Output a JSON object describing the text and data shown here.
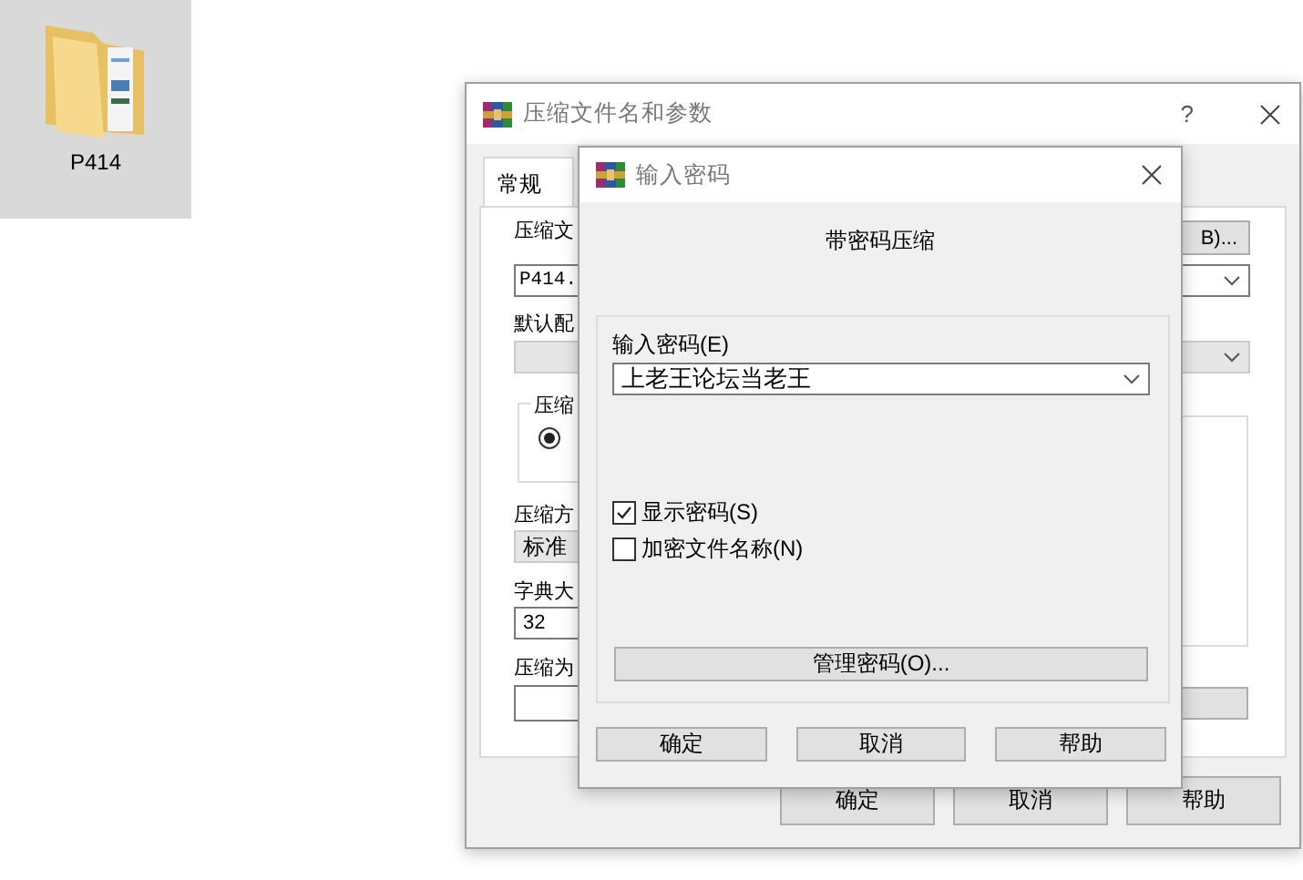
{
  "desktop_icons": [
    {
      "label": "P414",
      "selected": true
    }
  ],
  "back_window": {
    "title": "压缩文件名和参数",
    "help": "?",
    "tabs": [
      {
        "label": "常规",
        "selected": true
      }
    ],
    "archive_name_label": "压缩文",
    "browse_button": "B)...",
    "archive_name": "P414.",
    "profile_label": "默认配",
    "method_group_label": "压缩",
    "format_radio": {
      "selected": true
    },
    "method_label": "压缩方",
    "method_value": "标准",
    "dict_label": "字典大",
    "dict_value": "32",
    "split_label": "压缩为",
    "buttons": [
      "确定",
      "取消",
      "帮助"
    ]
  },
  "password_dialog": {
    "title": "输入密码",
    "heading": "带密码压缩",
    "password_label": "输入密码(E)",
    "password": "上老王论坛当老王",
    "options": [
      {
        "label": "显示密码(S)",
        "checked": true
      },
      {
        "label": "加密文件名称(N)",
        "checked": false
      }
    ],
    "manage_button": "管理密码(O)...",
    "buttons": [
      "确定",
      "取消",
      "帮助"
    ]
  }
}
